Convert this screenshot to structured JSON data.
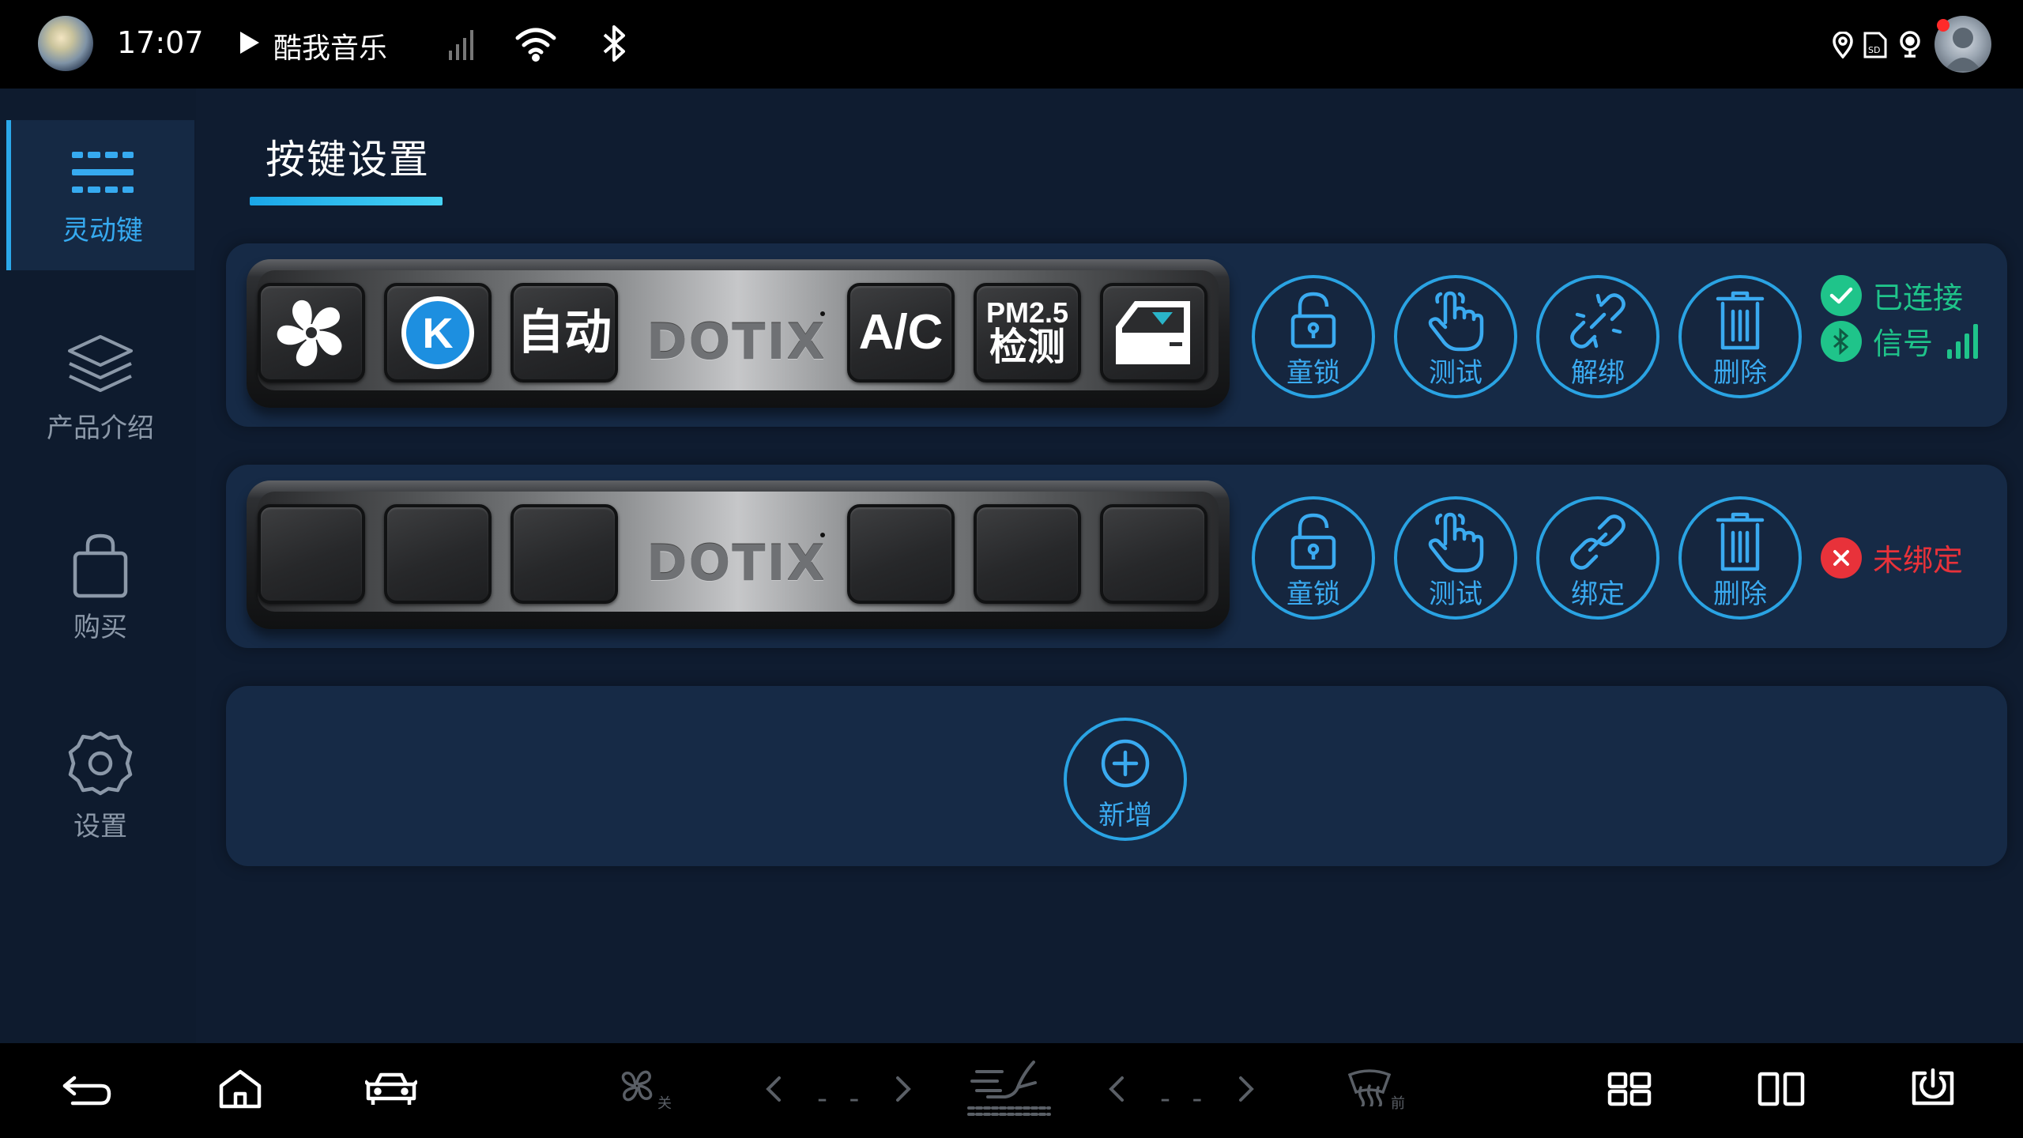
{
  "status_bar": {
    "time": "17:07",
    "music_app": "酷我音乐",
    "icons": [
      "avatar-icon",
      "play-icon",
      "signal-icon",
      "wifi-icon",
      "bluetooth-icon",
      "location-icon",
      "sd-card-icon",
      "record-icon",
      "user-icon"
    ]
  },
  "sidebar": {
    "items": [
      {
        "label": "灵动键",
        "icon": "keys-icon",
        "active": true
      },
      {
        "label": "产品介绍",
        "icon": "layers-icon",
        "active": false
      },
      {
        "label": "购买",
        "icon": "bag-icon",
        "active": false
      },
      {
        "label": "设置",
        "icon": "gear-icon",
        "active": false
      }
    ]
  },
  "page": {
    "title": "按键设置"
  },
  "devices": [
    {
      "logo": "DOTIX",
      "keys": [
        {
          "kind": "icon",
          "icon": "fan-icon"
        },
        {
          "kind": "icon",
          "icon": "k-icon",
          "text": "K"
        },
        {
          "kind": "text",
          "text": "自动"
        },
        {
          "kind": "text",
          "text": "A/C"
        },
        {
          "kind": "text2",
          "line1": "PM2.5",
          "line2": "检测"
        },
        {
          "kind": "icon",
          "icon": "window-icon"
        }
      ],
      "actions": [
        {
          "label": "童锁",
          "icon": "lock-icon"
        },
        {
          "label": "测试",
          "icon": "hand-icon"
        },
        {
          "label": "解绑",
          "icon": "unlink-icon"
        },
        {
          "label": "删除",
          "icon": "trash-icon"
        }
      ],
      "status": {
        "connection": "已连接",
        "signal": "信号"
      },
      "colors": {
        "status": "#1fc48a"
      }
    },
    {
      "logo": "DOTIX",
      "actions": [
        {
          "label": "童锁",
          "icon": "lock-icon"
        },
        {
          "label": "测试",
          "icon": "hand-icon"
        },
        {
          "label": "绑定",
          "icon": "link-icon"
        },
        {
          "label": "删除",
          "icon": "trash-icon"
        }
      ],
      "status": {
        "binding": "未绑定"
      },
      "colors": {
        "status": "#e8323a"
      }
    }
  ],
  "add": {
    "label": "新增",
    "icon": "plus-icon"
  },
  "nav_bar": {
    "fan_label": "关",
    "temp_left": "- -",
    "temp_right": "- -",
    "defrost_label": "前",
    "icons": [
      "back-icon",
      "home-icon",
      "car-icon",
      "fan-icon",
      "chevron-left-icon",
      "chevron-right-icon",
      "seat-icon",
      "chevron-left-icon",
      "chevron-right-icon",
      "defrost-icon",
      "grid-icon",
      "split-icon",
      "power-icon"
    ]
  },
  "colors": {
    "accent": "#2aa3e3",
    "background": "#0f1c30",
    "card": "#162a46"
  }
}
